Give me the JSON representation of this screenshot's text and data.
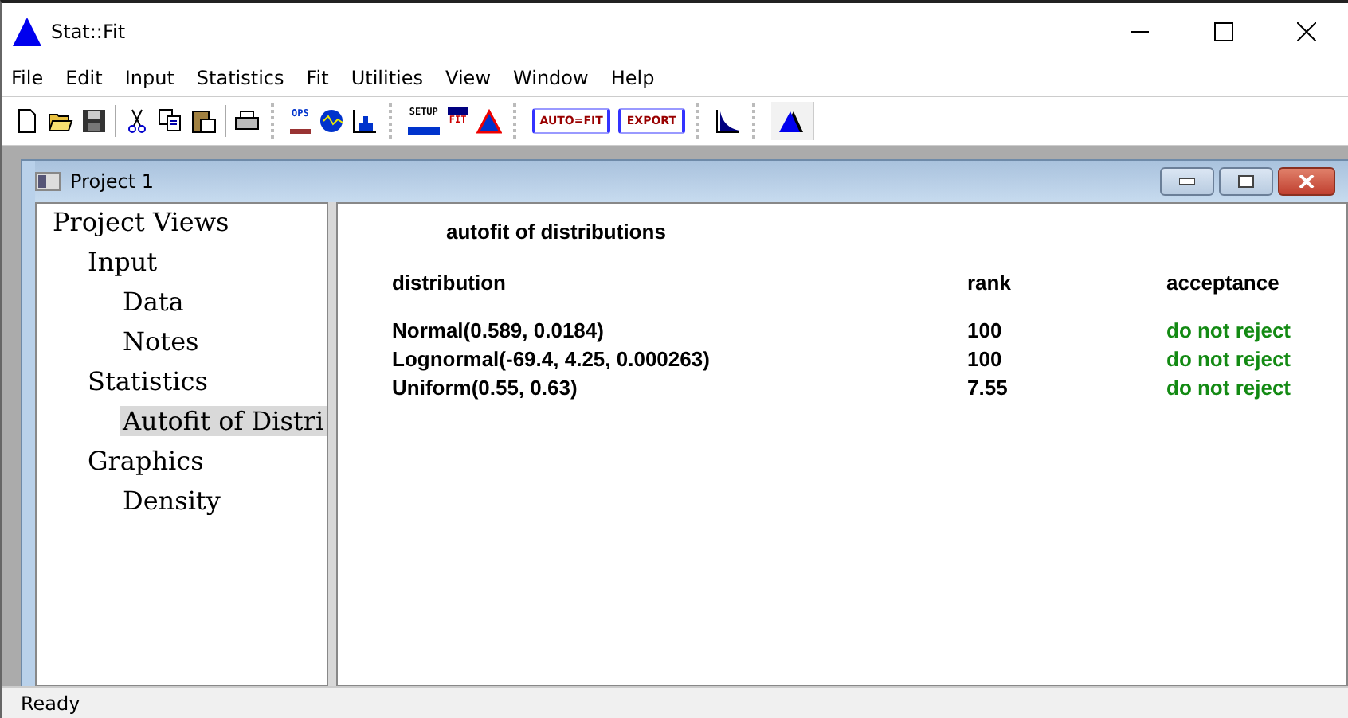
{
  "window": {
    "title": "Stat::Fit"
  },
  "menu": [
    "File",
    "Edit",
    "Input",
    "Statistics",
    "Fit",
    "Utilities",
    "View",
    "Window",
    "Help"
  ],
  "toolbar": [
    {
      "kind": "new"
    },
    {
      "kind": "open"
    },
    {
      "kind": "save"
    },
    {
      "kind": "sep"
    },
    {
      "kind": "cut"
    },
    {
      "kind": "copy"
    },
    {
      "kind": "paste"
    },
    {
      "kind": "sep"
    },
    {
      "kind": "print"
    },
    {
      "kind": "grip"
    },
    {
      "kind": "ops",
      "label": "OPS"
    },
    {
      "kind": "wave"
    },
    {
      "kind": "hist"
    },
    {
      "kind": "grip"
    },
    {
      "kind": "setup",
      "label": "SETUP"
    },
    {
      "kind": "fit",
      "label": "FIT"
    },
    {
      "kind": "peak"
    },
    {
      "kind": "grip"
    },
    {
      "kind": "textbtn",
      "label": "AUTO=FIT"
    },
    {
      "kind": "textbtn",
      "label": "EXPORT"
    },
    {
      "kind": "grip"
    },
    {
      "kind": "decay"
    },
    {
      "kind": "grip"
    },
    {
      "kind": "logo"
    }
  ],
  "child_window": {
    "title": "Project 1"
  },
  "tree": [
    {
      "label": "Project Views",
      "selected": false,
      "children": [
        {
          "label": "Input",
          "selected": false,
          "children": [
            {
              "label": "Data",
              "selected": false
            },
            {
              "label": "Notes",
              "selected": false
            }
          ]
        },
        {
          "label": "Statistics",
          "selected": false,
          "children": [
            {
              "label": "Autofit of Distri",
              "selected": true
            }
          ]
        },
        {
          "label": "Graphics",
          "selected": false,
          "children": [
            {
              "label": "Density",
              "selected": false
            }
          ]
        }
      ]
    }
  ],
  "report": {
    "title": "autofit of distributions",
    "columns": [
      "distribution",
      "rank",
      "acceptance"
    ],
    "rows": [
      {
        "distribution": "Normal(0.589, 0.0184)",
        "rank": "100",
        "acceptance": "do not reject"
      },
      {
        "distribution": "Lognormal(-69.4, 4.25, 0.000263)",
        "rank": "100",
        "acceptance": "do not reject"
      },
      {
        "distribution": "Uniform(0.55, 0.63)",
        "rank": "7.55",
        "acceptance": "do not reject"
      }
    ]
  },
  "status_bar": {
    "text": "Ready"
  }
}
